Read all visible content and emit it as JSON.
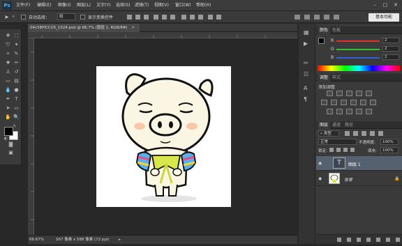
{
  "app": {
    "logo": "Ps"
  },
  "menu": [
    {
      "label": "文件(F)"
    },
    {
      "label": "编辑(E)"
    },
    {
      "label": "图像(I)"
    },
    {
      "label": "图层(L)"
    },
    {
      "label": "文字(Y)"
    },
    {
      "label": "选择(S)"
    },
    {
      "label": "滤镜(T)"
    },
    {
      "label": "视图(V)"
    },
    {
      "label": "窗口(W)"
    },
    {
      "label": "帮助(H)"
    }
  ],
  "window_controls": {
    "minimize": "–",
    "restore": "□",
    "close": "✕"
  },
  "options": {
    "auto_select_label": "自动选择：",
    "auto_select_value": "组",
    "show_transform_label": "显示变换控件",
    "workspace_button": "基本功能"
  },
  "document": {
    "tab_title": "04c58PICCU5_1024.psd @ 66.7% (图层 1, RGB/8#)",
    "close_icon": "✕",
    "zoom": "66.67%",
    "doc_info": "567 像素 x 588 像素 (72 ppi)"
  },
  "panels": {
    "color_tabs": [
      "颜色",
      "色板"
    ],
    "rgb": [
      {
        "channel": "R",
        "value": "2",
        "color": "#e03030"
      },
      {
        "channel": "G",
        "value": "2",
        "color": "#30c030"
      },
      {
        "channel": "B",
        "value": "2",
        "color": "#3060e0"
      }
    ],
    "adjust_tabs": [
      "调整",
      "样式"
    ],
    "adjust_title": "添加调整",
    "layers_tabs": [
      "图层",
      "通道",
      "路径"
    ],
    "kind_filter": "类型",
    "blend_mode": "正常",
    "opacity_label": "不透明度:",
    "opacity_value": "100%",
    "lock_label": "锁定:",
    "fill_label": "填充:",
    "fill_value": "100%",
    "layers": [
      {
        "name": "图层 1",
        "type": "text",
        "thumb": "T",
        "selected": true
      },
      {
        "name": "背景",
        "type": "background",
        "selected": false
      }
    ]
  },
  "colors": {
    "accent_selected_layer": "#55616f",
    "foreground": "#000000",
    "background": "#ffffff"
  }
}
